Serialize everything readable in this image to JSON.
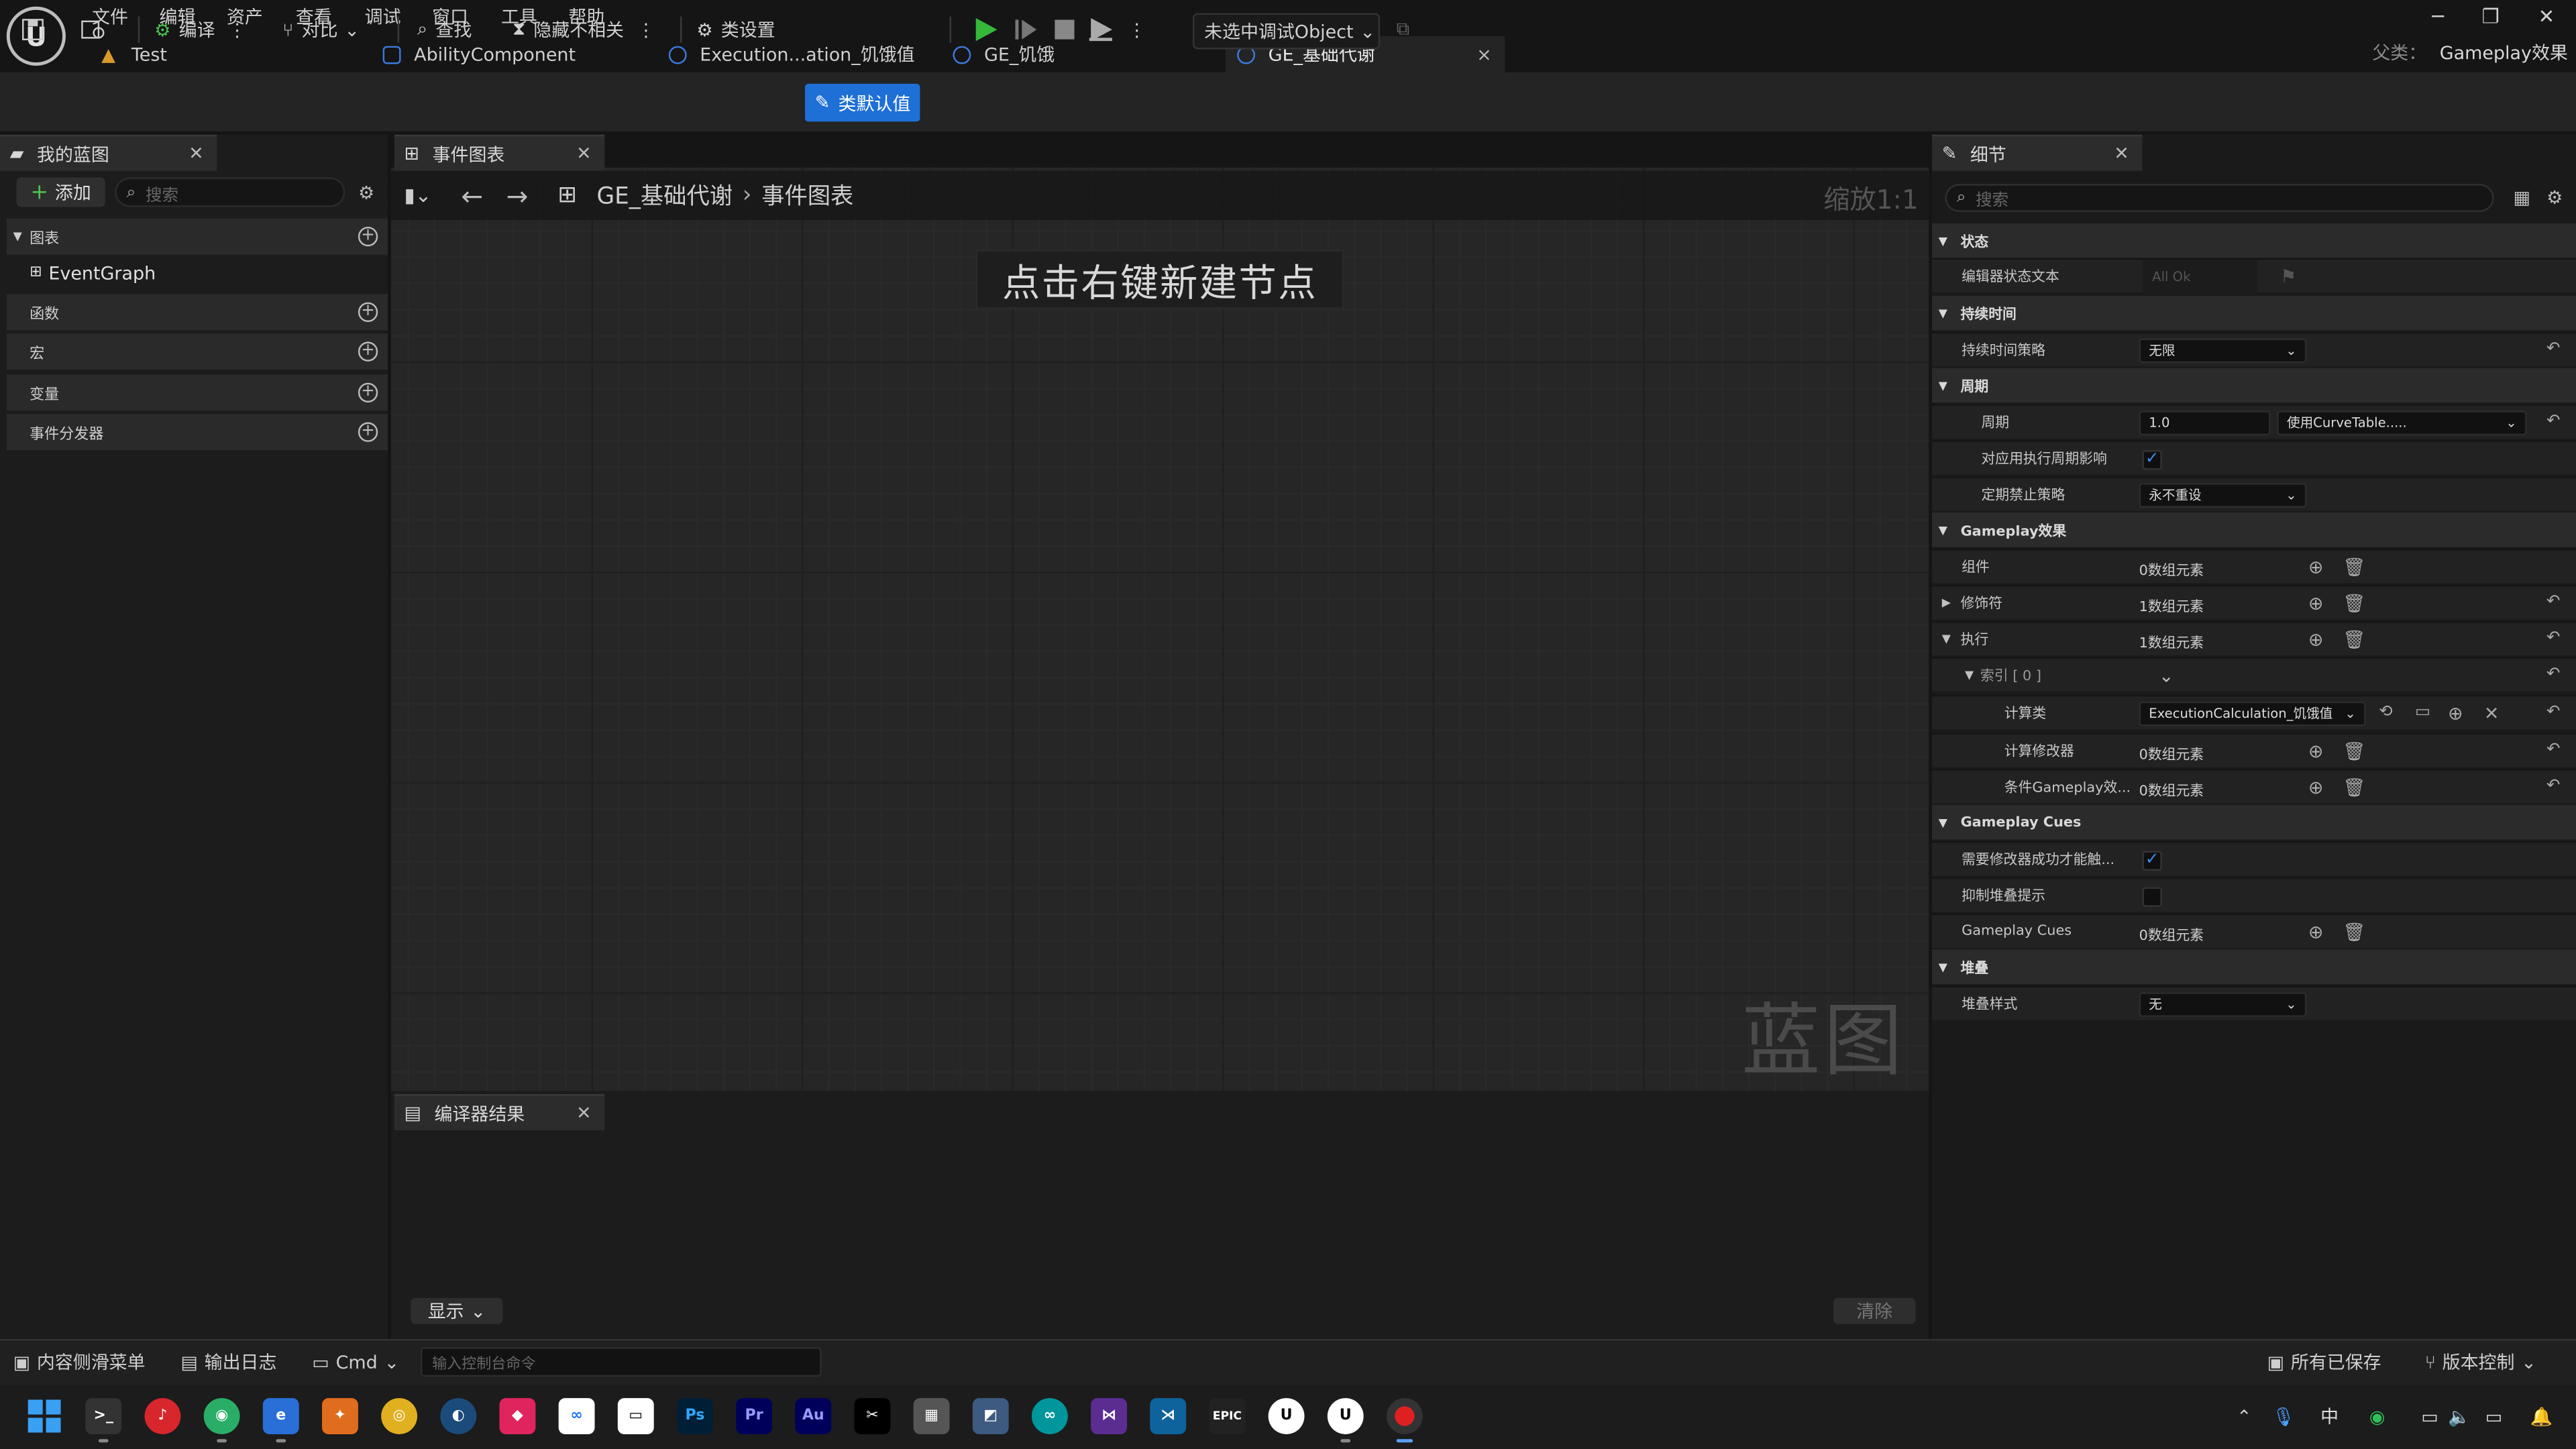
{
  "menu": [
    "文件",
    "编辑",
    "资产",
    "查看",
    "调试",
    "窗口",
    "工具",
    "帮助"
  ],
  "tabs": [
    {
      "label": "Test",
      "icon": "warning-icon"
    },
    {
      "label": "AbilityComponent",
      "icon": "blueprint-icon"
    },
    {
      "label": "Execution...ation_饥饿值",
      "icon": "blueprint-icon"
    },
    {
      "label": "GE_饥饿",
      "icon": "blueprint-icon"
    },
    {
      "label": "GE_基础代谢",
      "icon": "blueprint-icon",
      "close": "×"
    }
  ],
  "parent": {
    "label": "父类：",
    "value": "Gameplay效果"
  },
  "toolbar": {
    "compile": "编译",
    "diff": "对比",
    "find": "查找",
    "hide_unrelated": "隐藏不相关",
    "class_settings": "类设置",
    "class_defaults": "类默认值",
    "debug_object": "未选中调试Object"
  },
  "left": {
    "tab": "我的蓝图",
    "add": "添加",
    "search_placeholder": "搜索",
    "sections": [
      {
        "label": "图表"
      },
      {
        "label": "函数"
      },
      {
        "label": "宏"
      },
      {
        "label": "变量"
      },
      {
        "label": "事件分发器"
      }
    ],
    "graph_item": "EventGraph"
  },
  "graph": {
    "tab": "事件图表",
    "crumb_root": "GE_基础代谢",
    "crumb_current": "事件图表",
    "zoom": "缩放1:1",
    "hint": "点击右键新建节点",
    "watermark": "蓝图"
  },
  "compiler": {
    "tab": "编译器结果",
    "show": "显示",
    "clear": "清除"
  },
  "details": {
    "tab": "细节",
    "search_placeholder": "搜索",
    "status_section": "状态",
    "editor_state_label": "编辑器状态文本",
    "editor_state_value": "All Ok",
    "duration_section": "持续时间",
    "duration_policy_label": "持续时间策略",
    "duration_policy_value": "无限",
    "period_section": "周期",
    "period_label": "周期",
    "period_value": "1.0",
    "curve_table": "使用CurveTable.....",
    "exec_on_apply_label": "对应用执行周期影响",
    "exec_on_apply_checked": "✓",
    "inhibition_label": "定期禁止策略",
    "inhibition_value": "永不重设",
    "gameplay_section": "Gameplay效果",
    "components_label": "组件",
    "components_value": "0数组元素",
    "modifiers_label": "修饰符",
    "modifiers_value": "1数组元素",
    "executions_label": "执行",
    "executions_value": "1数组元素",
    "index_label": "索引 [ 0 ]",
    "calc_class_label": "计算类",
    "calc_class_value": "ExecutionCalculation_饥饿值",
    "calc_modifiers_label": "计算修改器",
    "calc_modifiers_value": "0数组元素",
    "conditional_label": "条件Gameplay效...",
    "conditional_value": "0数组元素",
    "cues_section": "Gameplay Cues",
    "require_success_label": "需要修改器成功才能触...",
    "require_success_checked": "✓",
    "suppress_stacking_label": "抑制堆叠提示",
    "cues_label": "Gameplay Cues",
    "cues_value": "0数组元素",
    "stacking_section": "堆叠",
    "stacking_type_label": "堆叠样式",
    "stacking_type_value": "无"
  },
  "statusbar": {
    "content_drawer": "内容侧滑菜单",
    "output_log": "输出日志",
    "cmd": "Cmd",
    "cmd_placeholder": "输入控制台命令",
    "all_saved": "所有已保存",
    "version_control": "版本控制"
  },
  "taskbar": {
    "ime": "中"
  },
  "colors": {
    "accent": "#1e6fd6",
    "play": "#35b83a",
    "checkbox": "#3e8cf0"
  }
}
